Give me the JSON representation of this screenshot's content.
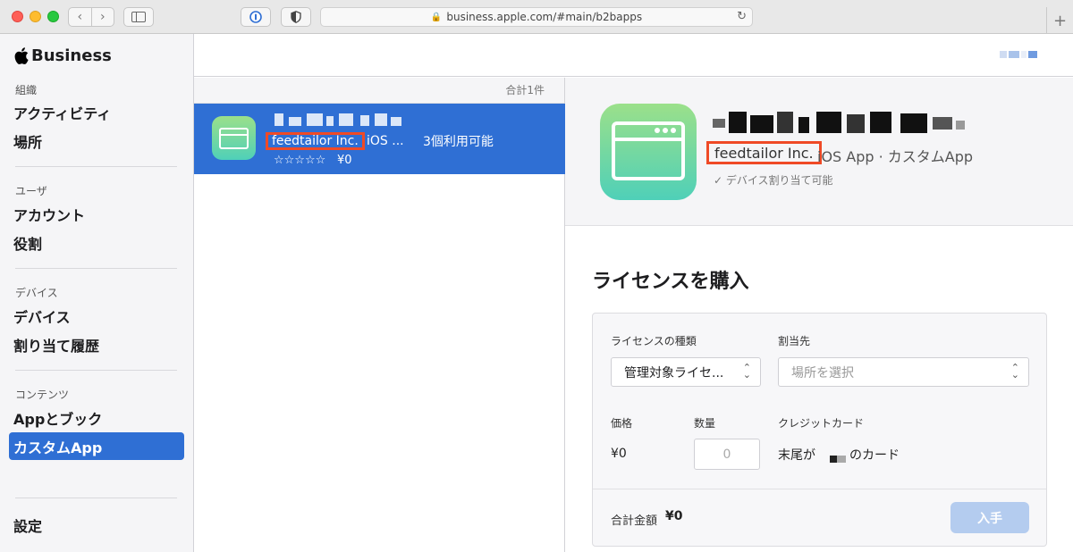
{
  "browser": {
    "url": "business.apple.com/#main/b2bapps",
    "new_tab": "+"
  },
  "sidebar": {
    "brand": "Business",
    "sections": [
      {
        "label": "組織",
        "items": [
          "アクティビティ",
          "場所"
        ]
      },
      {
        "label": "ユーザ",
        "items": [
          "アカウント",
          "役割"
        ]
      },
      {
        "label": "デバイス",
        "items": [
          "デバイス",
          "割り当て履歴"
        ]
      },
      {
        "label": "コンテンツ",
        "items": [
          "Appとブック",
          "カスタムApp"
        ]
      }
    ],
    "active_item": "カスタムApp",
    "settings": "設定"
  },
  "list": {
    "count_label": "合計1件",
    "rows": [
      {
        "publisher": "feedtailor Inc.",
        "type": "iOS ...",
        "availability": "3個利用可能",
        "rating": "☆☆☆☆☆",
        "price": "¥0"
      }
    ]
  },
  "detail": {
    "publisher": "feedtailor Inc.",
    "type_line": "iOS App · カスタムApp",
    "assign_note": "✓ デバイス割り当て可能",
    "purchase_title": "ライセンスを購入",
    "form": {
      "license_type_label": "ライセンスの種類",
      "license_type_value": "管理対象ライセ...",
      "assign_to_label": "割当先",
      "assign_to_placeholder": "場所を選択",
      "price_label": "価格",
      "price_value": "¥0",
      "quantity_label": "数量",
      "quantity_placeholder": "0",
      "credit_card_label": "クレジットカード",
      "credit_card_prefix": "末尾が",
      "credit_card_suffix": "のカード",
      "total_label": "合計金額",
      "total_value": "¥0",
      "buy_button": "入手"
    }
  },
  "colors": {
    "accent": "#2f6fd4",
    "highlight_box": "#ef4a26",
    "icon_gradient_top": "#9be08a",
    "icon_gradient_bottom": "#4fd0b8",
    "buy_disabled": "#b4ccef"
  }
}
